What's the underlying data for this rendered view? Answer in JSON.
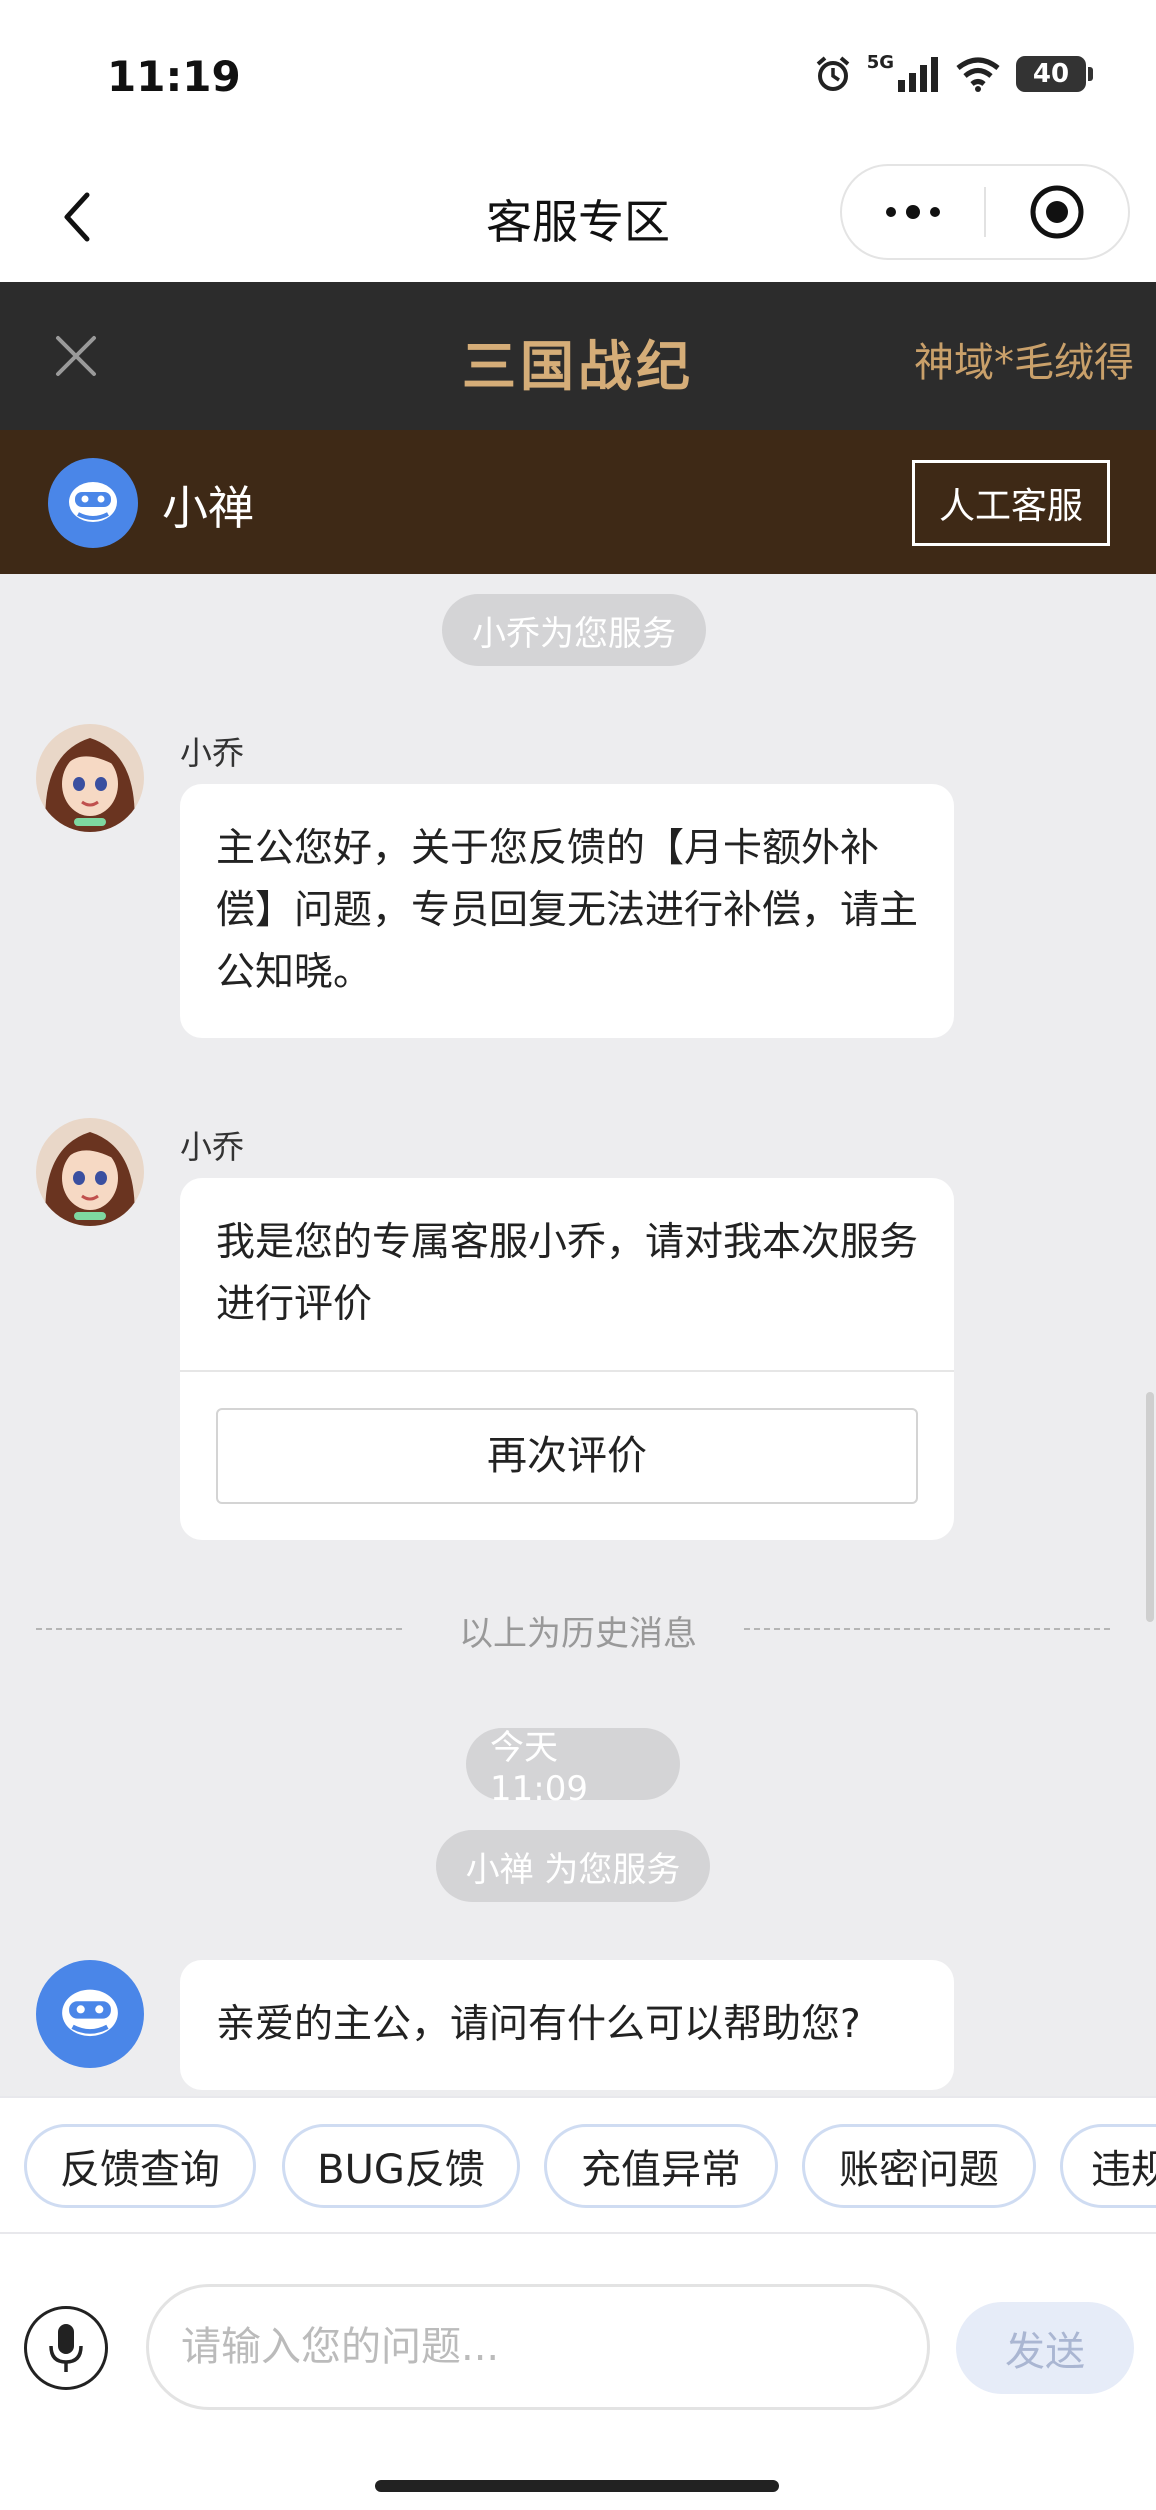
{
  "status_bar": {
    "time": "11:19",
    "network": "5G",
    "battery": "40"
  },
  "nav": {
    "title": "客服专区",
    "more_icon": "more-dots-icon",
    "close_icon": "target-circle-icon"
  },
  "game_header": {
    "title": "三国战纪",
    "marquee": "神域*毛绒得"
  },
  "bot_bar": {
    "name": "小禅",
    "human_button": "人工客服"
  },
  "chat": {
    "service_pill_1": "小乔为您服务",
    "messages": [
      {
        "sender": "小乔",
        "text": "主公您好，关于您反馈的【月卡额外补偿】问题，专员回复无法进行补偿，请主公知晓。"
      },
      {
        "sender": "小乔",
        "text": "我是您的专属客服小乔，请对我本次服务进行评价",
        "button": "再次评价"
      }
    ],
    "history_divider": "以上为历史消息",
    "time_pill": "今天 11:09",
    "service_pill_2": "小禅 为您服务",
    "bot_message": "亲爱的主公，请问有什么可以帮助您?"
  },
  "quick_tags": [
    "反馈查询",
    "BUG反馈",
    "充值异常",
    "账密问题",
    "违规"
  ],
  "input": {
    "placeholder": "请输入您的问题...",
    "send_label": "发送"
  },
  "colors": {
    "game_header_bg": "#2c2c2c",
    "bot_bar_bg": "#3e2916",
    "gold": "#d5ad78",
    "bot_blue": "#4a86e8"
  }
}
